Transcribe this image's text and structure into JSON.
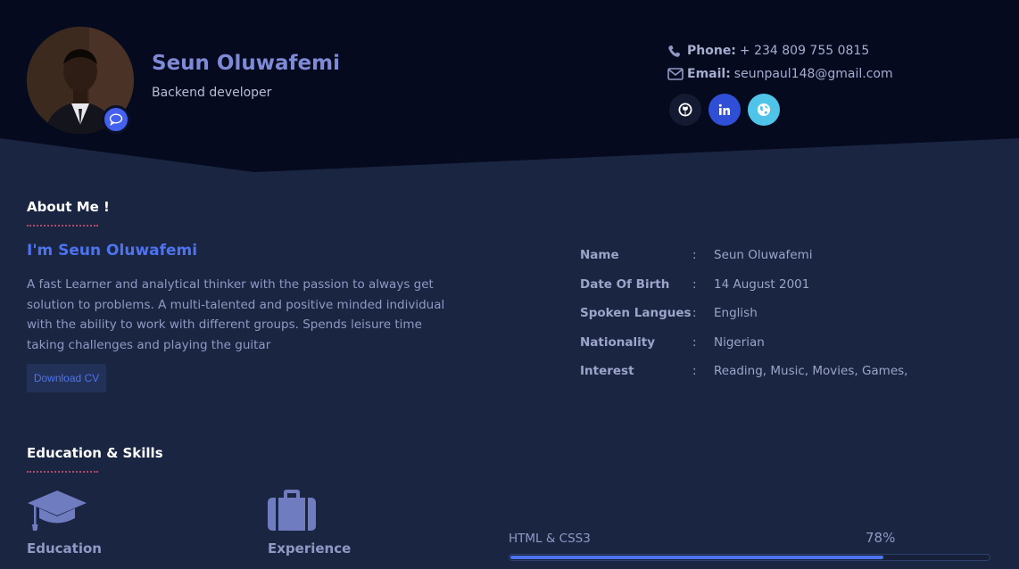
{
  "profile": {
    "name": "Seun Oluwafemi",
    "role": "Backend developer"
  },
  "contact": {
    "phone_label": "Phone:",
    "phone": "+ 234 809 755 0815",
    "email_label": "Email:",
    "email": "seunpaul148@gmail.com"
  },
  "socials": [
    {
      "icon": "github-icon",
      "color": "#151a33"
    },
    {
      "icon": "linkedin-icon",
      "color": "#2f4fd6"
    },
    {
      "icon": "globe-icon",
      "color": "#4fc3e8"
    }
  ],
  "about": {
    "section_title": "About Me !",
    "intro": "I'm Seun Oluwafemi",
    "text": "A fast Learner and analytical thinker with the passion to always get solution to problems. A multi-talented and positive minded individual with the ability to work with different groups. Spends leisure time taking challenges and playing the guitar",
    "cv_button": "Download CV"
  },
  "info": [
    {
      "label": "Name",
      "value": "Seun Oluwafemi"
    },
    {
      "label": "Date Of Birth",
      "value": "14 August 2001"
    },
    {
      "label": "Spoken Langues",
      "value": "English"
    },
    {
      "label": "Nationality",
      "value": "Nigerian"
    },
    {
      "label": "Interest",
      "value": "Reading, Music, Movies, Games,"
    }
  ],
  "info_separator": ":",
  "education": {
    "section_title": "Education & Skills",
    "education_label": "Education",
    "experience_label": "Experience"
  },
  "skills": [
    {
      "label": "HTML & CSS3",
      "percent_text": "78%",
      "percent": 78
    }
  ],
  "colors": {
    "header_bg": "#050a1e",
    "body_bg": "#1a2542",
    "accent": "#4d73f0",
    "name": "#7f8ad6"
  }
}
